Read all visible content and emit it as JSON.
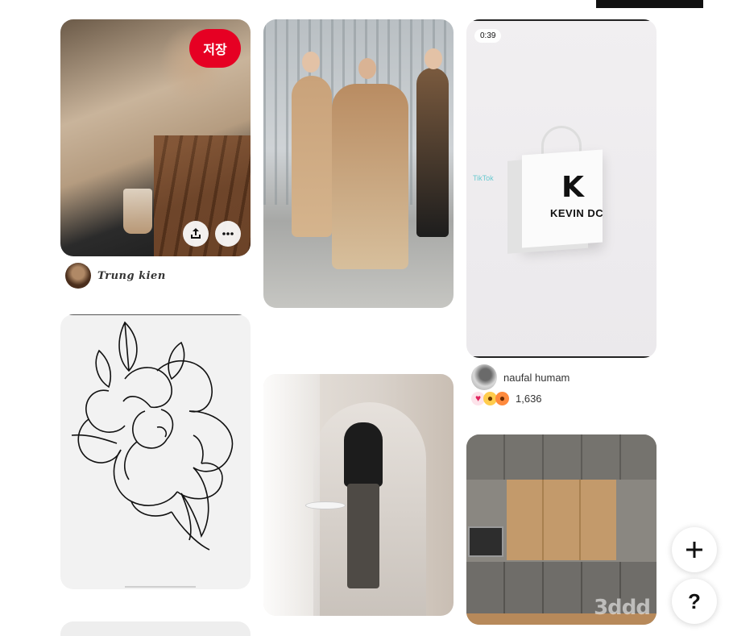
{
  "pins": {
    "man_blazer": {
      "save_label": "저장",
      "share_icon": "share-icon",
      "more_icon": "more-icon"
    },
    "man_blazer_attribution": {
      "name": "Trung kien"
    },
    "video_pin": {
      "duration": "0:39",
      "bag_brand": "KEVIN DC",
      "tiktok_mark": "TikTok"
    },
    "video_attribution": {
      "name": "naufal humam"
    },
    "video_reactions": {
      "icons": [
        "heart-icon",
        "wow-icon",
        "shock-icon"
      ],
      "count": "1,636"
    },
    "kitchen_pin": {
      "watermark": "3ddd"
    }
  },
  "floating_actions": {
    "add_icon": "plus-icon",
    "help_label": "?"
  },
  "colors": {
    "save": "#e60023",
    "background": "#ffffff"
  }
}
